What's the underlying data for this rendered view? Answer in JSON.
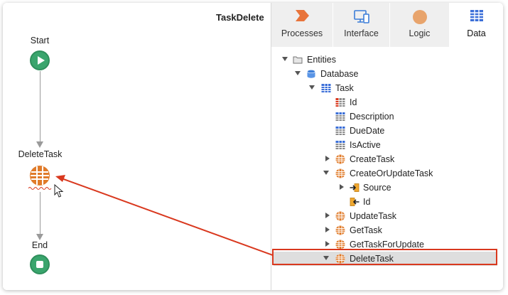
{
  "flow": {
    "title": "TaskDelete",
    "start_label": "Start",
    "action_label": "DeleteTask",
    "end_label": "End"
  },
  "tabs": [
    {
      "label": "Processes",
      "icon": "processes-icon",
      "color": "#e8743b",
      "active": false
    },
    {
      "label": "Interface",
      "icon": "interface-icon",
      "color": "#3b7dd8",
      "active": false
    },
    {
      "label": "Logic",
      "icon": "logic-icon",
      "color": "#e8a46c",
      "active": false
    },
    {
      "label": "Data",
      "icon": "data-icon",
      "color": "#3b6fd8",
      "active": true
    }
  ],
  "tree": [
    {
      "label": "Entities",
      "icon": "folder-icon",
      "caret": "down"
    },
    {
      "label": "Database",
      "icon": "database-icon",
      "caret": "down"
    },
    {
      "label": "Task",
      "icon": "entity-icon",
      "caret": "down"
    },
    {
      "label": "Id",
      "icon": "id-attribute-icon",
      "caret": ""
    },
    {
      "label": "Description",
      "icon": "attribute-icon",
      "caret": ""
    },
    {
      "label": "DueDate",
      "icon": "attribute-icon",
      "caret": ""
    },
    {
      "label": "IsActive",
      "icon": "attribute-icon",
      "caret": ""
    },
    {
      "label": "CreateTask",
      "icon": "entity-action-icon",
      "caret": "right"
    },
    {
      "label": "CreateOrUpdateTask",
      "icon": "entity-action-icon",
      "caret": "down"
    },
    {
      "label": "Source",
      "icon": "input-parameter-icon",
      "caret": "right"
    },
    {
      "label": "Id",
      "icon": "output-parameter-icon",
      "caret": ""
    },
    {
      "label": "UpdateTask",
      "icon": "entity-action-icon",
      "caret": "right"
    },
    {
      "label": "GetTask",
      "icon": "entity-action-icon",
      "caret": "right"
    },
    {
      "label": "GetTaskForUpdate",
      "icon": "entity-action-icon",
      "caret": "right"
    },
    {
      "label": "DeleteTask",
      "icon": "entity-action-icon",
      "caret": "down",
      "selected": true
    }
  ],
  "colors": {
    "start_end": "#3aa56d",
    "entity_action": "#e07b2a",
    "highlight": "#d9381e",
    "selected_row": "#dedede"
  }
}
